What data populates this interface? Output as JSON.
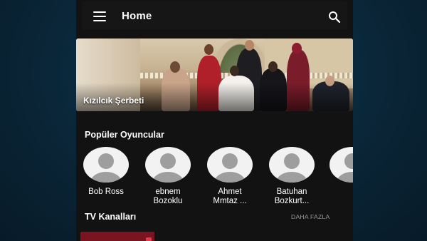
{
  "app": {
    "title": "Home",
    "menu_icon": "hamburger-menu-icon",
    "search_icon": "search-icon"
  },
  "banner": {
    "title": "Kızılcık Şerbeti"
  },
  "popular_actors": {
    "heading": "Popüler Oyuncular",
    "items": [
      {
        "name_line1": "Bob Ross",
        "name_line2": ""
      },
      {
        "name_line1": "ebnem",
        "name_line2": "Bozoklu"
      },
      {
        "name_line1": "Ahmet",
        "name_line2": "Mmtaz ..."
      },
      {
        "name_line1": "Batuhan",
        "name_line2": "Bozkurt..."
      }
    ]
  },
  "tv_channels": {
    "heading": "TV Kanalları",
    "more_label": "DAHA FAZLA"
  },
  "colors": {
    "app_background": "#121212",
    "outer_background": "#0a2638",
    "channel_card": "#7a1420"
  }
}
